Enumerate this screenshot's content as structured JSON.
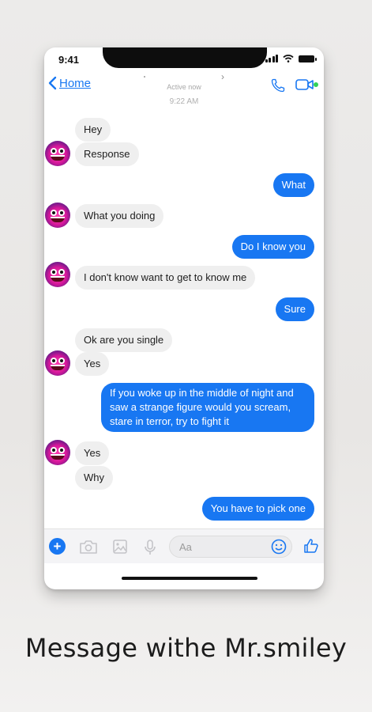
{
  "status": {
    "time": "9:41"
  },
  "header": {
    "back_label": "Home",
    "active_status": "Active now",
    "timestamp": "9:22 AM"
  },
  "messages": [
    {
      "side": "in",
      "text": "Hey"
    },
    {
      "side": "in",
      "text": "Response"
    },
    {
      "side": "out",
      "text": "What"
    },
    {
      "side": "in",
      "text": "What you doing"
    },
    {
      "side": "out",
      "text": "Do I know you"
    },
    {
      "side": "in",
      "text": "I don't know want to get to know me"
    },
    {
      "side": "out",
      "text": "Sure"
    },
    {
      "side": "in",
      "text": "Ok are you single"
    },
    {
      "side": "in",
      "text": "Yes"
    },
    {
      "side": "out",
      "text": "If you woke up in the middle of night and saw a strange figure would you scream, stare in terror, try to fight it"
    },
    {
      "side": "in",
      "text": "Yes"
    },
    {
      "side": "in",
      "text": "Why"
    },
    {
      "side": "out",
      "text": "You have to pick one"
    }
  ],
  "composer": {
    "placeholder": "Aa"
  },
  "caption": "Message withe Mr.smiley",
  "colors": {
    "accent": "#1877f2",
    "incoming_bubble": "#efefef",
    "online": "#31d158"
  },
  "icons": [
    "call-icon",
    "video-call-icon",
    "plus-icon",
    "camera-icon",
    "image-icon",
    "microphone-icon",
    "emoji-icon",
    "like-icon"
  ]
}
